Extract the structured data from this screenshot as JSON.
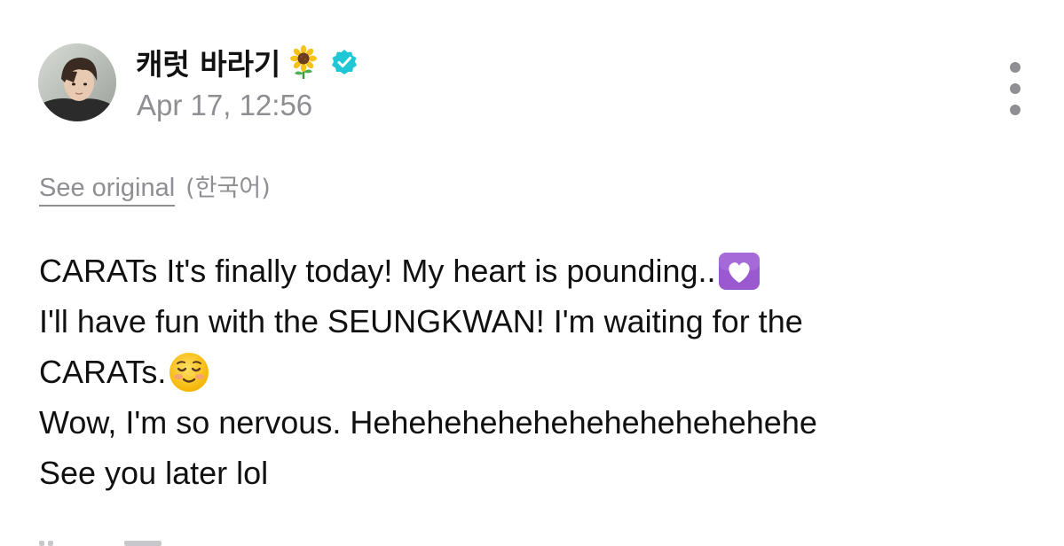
{
  "author": {
    "name": "캐럿 바라기",
    "name_emoji": "sunflower-icon",
    "verified": true,
    "verified_color": "#1fc7d4"
  },
  "post": {
    "date": "Apr 17, 12:56",
    "translation": {
      "see_original_label": "See original",
      "language": "(한국어)"
    },
    "lines": [
      "CARATs It's finally today! My heart is pounding..",
      "I'll have fun with the SEUNGKWAN! I'm waiting for the",
      "CARATs.",
      "Wow, I'm so nervous. Hehehehehehehehehehehehehe",
      "See you later lol"
    ],
    "line_emojis": {
      "line_0": "purple-heart-emoji",
      "line_2": "smiling-face-emoji"
    }
  },
  "menu": {
    "icon": "more-vertical-icon"
  },
  "colors": {
    "text": "#111111",
    "secondary": "#8e8e93",
    "verified": "#1fc7d4",
    "heart_bg": "#9b59d0"
  }
}
